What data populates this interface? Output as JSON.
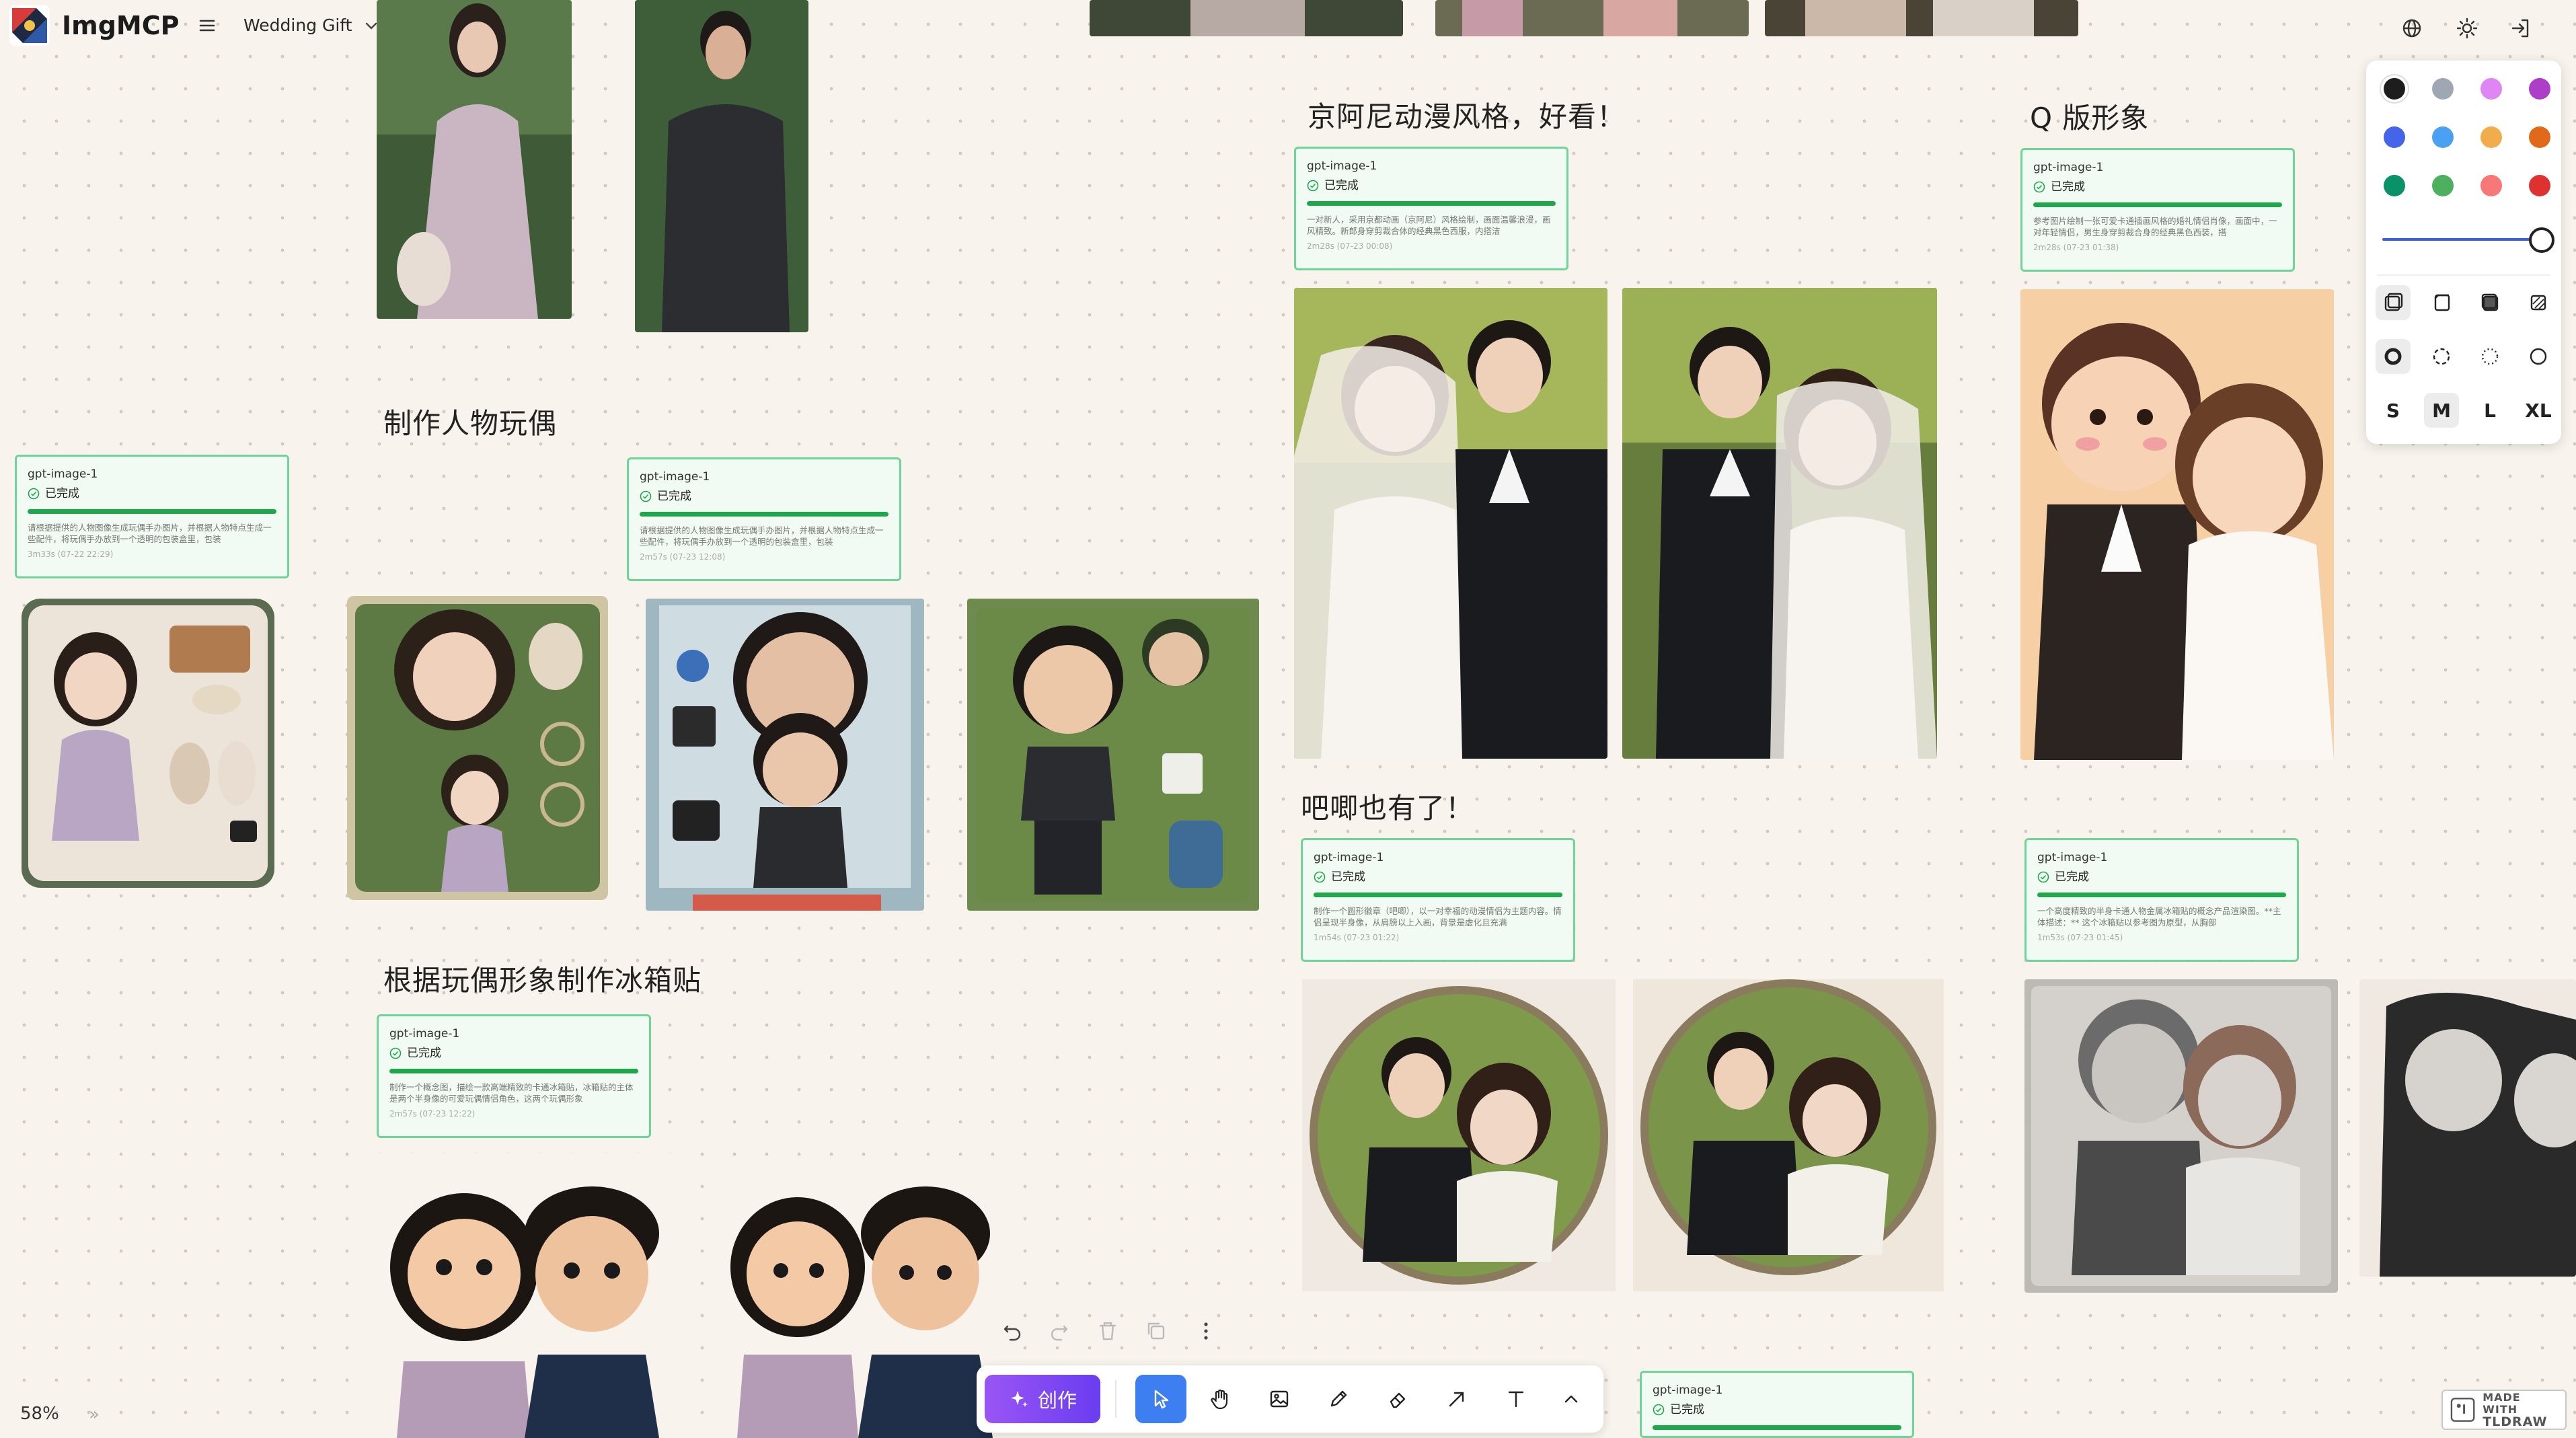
{
  "header": {
    "app_name": "ImgMCP",
    "doc_title": "Wedding Gift"
  },
  "sections": {
    "doll": "制作人物玩偶",
    "fridge": "根据玩偶形象制作冰箱贴",
    "kyoani": "京阿尼动漫风格，好看！",
    "chibi": "Q 版形象",
    "badge": "吧唧也有了！"
  },
  "cards": [
    {
      "model": "gpt-image-1",
      "status": "已完成",
      "desc": "请根据提供的人物图像生成玩偶手办图片，并根据人物特点生成一些配件，将玩偶手办放到一个透明的包装盒里，包装",
      "meta": "3m33s (07-22 22:29)"
    },
    {
      "model": "gpt-image-1",
      "status": "已完成",
      "desc": "请根据提供的人物图像生成玩偶手办图片，并根据人物特点生成一些配件，将玩偶手办放到一个透明的包装盒里，包装",
      "meta": "2m57s (07-23 12:08)"
    },
    {
      "model": "gpt-image-1",
      "status": "已完成",
      "desc": "制作一个概念图，描绘一款高端精致的卡通冰箱贴，冰箱贴的主体是两个半身像的可爱玩偶情侣角色，这两个玩偶形象",
      "meta": "2m57s (07-23 12:22)"
    },
    {
      "model": "gpt-image-1",
      "status": "已完成",
      "desc": "一对新人，采用京都动画（京阿尼）风格绘制，画面温馨浪漫，画风精致。新郎身穿剪裁合体的经典黑色西服，内搭洁",
      "meta": "2m28s (07-23 00:08)"
    },
    {
      "model": "gpt-image-1",
      "status": "已完成",
      "desc": "参考图片绘制一张可爱卡通插画风格的婚礼情侣肖像，画面中，一对年轻情侣，男生身穿剪裁合身的经典黑色西装，搭",
      "meta": "2m28s (07-23 01:38)"
    },
    {
      "model": "gpt-image-1",
      "status": "已完成",
      "desc": "制作一个圆形徽章（吧唧），以一对幸福的动漫情侣为主题内容。情侣呈现半身像，从肩膀以上入画，背景是虚化且充满",
      "meta": "1m54s (07-23 01:22)"
    },
    {
      "model": "gpt-image-1",
      "status": "已完成",
      "desc": "一个高度精致的半身卡通人物金属冰箱贴的概念产品渲染图。**主体描述：** 这个冰箱贴以参考图为原型，从胸部",
      "meta": "1m53s (07-23 01:45)"
    },
    {
      "model": "gpt-image-1",
      "status": "已完成",
      "desc": "",
      "meta": ""
    }
  ],
  "toolbar": {
    "create_label": "创作",
    "tools": [
      "select-tool",
      "hand-tool",
      "image-tool",
      "draw-tool",
      "eraser-tool",
      "arrow-tool",
      "text-tool",
      "more-tools"
    ]
  },
  "style_panel": {
    "colors": [
      "#1d1d1d",
      "#9fa8b2",
      "#e085f4",
      "#ae3ec9",
      "#4465e9",
      "#4ba1f1",
      "#f1ac4b",
      "#e16919",
      "#099268",
      "#4cb05e",
      "#f87777",
      "#e03131"
    ],
    "sizes": [
      "S",
      "M",
      "L",
      "XL"
    ],
    "selected_size": "M"
  },
  "zoom": {
    "level": "58%"
  },
  "branding": {
    "badge_line1": "MADE WITH",
    "badge_line2": "TLDRAW"
  }
}
